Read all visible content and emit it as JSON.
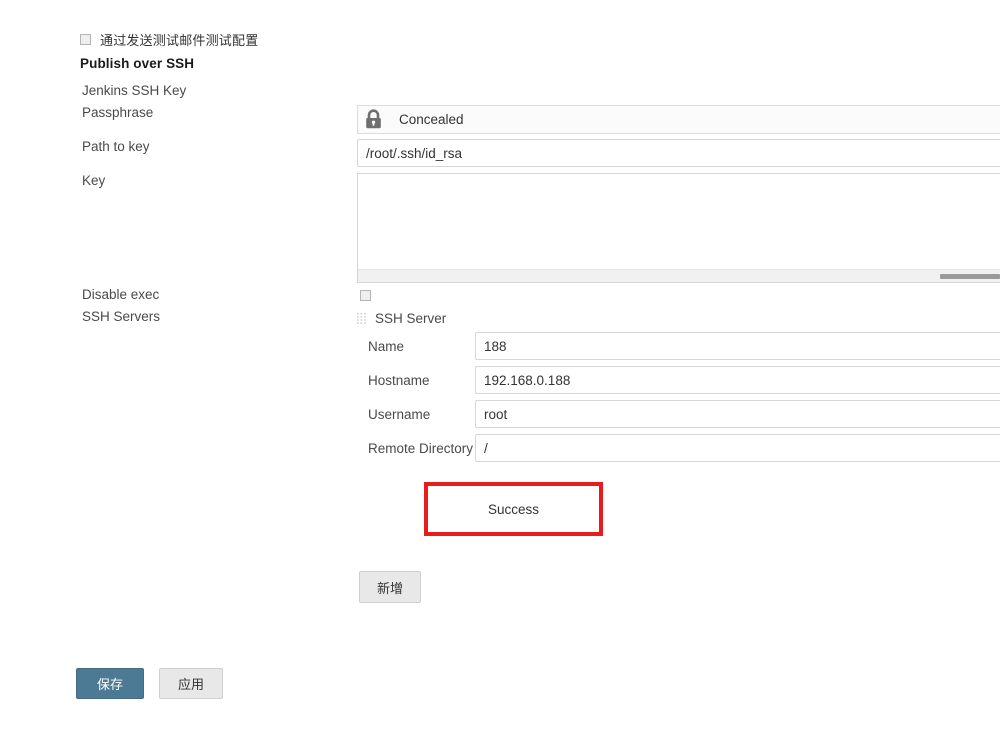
{
  "test_config": {
    "checkbox_label": "通过发送测试邮件测试配置",
    "checked": false,
    "icon": "checkbox-unchecked"
  },
  "section": {
    "title": "Publish over SSH"
  },
  "labels": {
    "jenkins_ssh_key": "Jenkins SSH Key",
    "passphrase": "Passphrase",
    "path_to_key": "Path to key",
    "key": "Key",
    "disable_exec": "Disable exec",
    "ssh_servers": "SSH Servers"
  },
  "fields": {
    "passphrase": {
      "value": "Concealed",
      "icon": "lock-icon",
      "readonly": true
    },
    "path_to_key": {
      "value": "/root/.ssh/id_rsa",
      "placeholder": ""
    },
    "key": {
      "value": "",
      "placeholder": ""
    },
    "disable_exec": {
      "checked": false,
      "icon": "checkbox-unchecked"
    }
  },
  "ssh_server": {
    "header": "SSH Server",
    "drag_handle_icon": "drag-grip-icon",
    "rows": [
      {
        "label": "Name",
        "value": "188"
      },
      {
        "label": "Hostname",
        "value": "192.168.0.188"
      },
      {
        "label": "Username",
        "value": "root"
      },
      {
        "label": "Remote Directory",
        "value": "/"
      }
    ]
  },
  "test_result": {
    "text": "Success",
    "highlight_color": "#e81c1c"
  },
  "buttons": {
    "add": "新增",
    "save": "保存",
    "apply": "应用"
  },
  "colors": {
    "save_button": "#4c7a94",
    "neutral_button": "#e8e8e8",
    "annotation_red": "#e81c1c",
    "field_border": "#d6d6d6"
  }
}
